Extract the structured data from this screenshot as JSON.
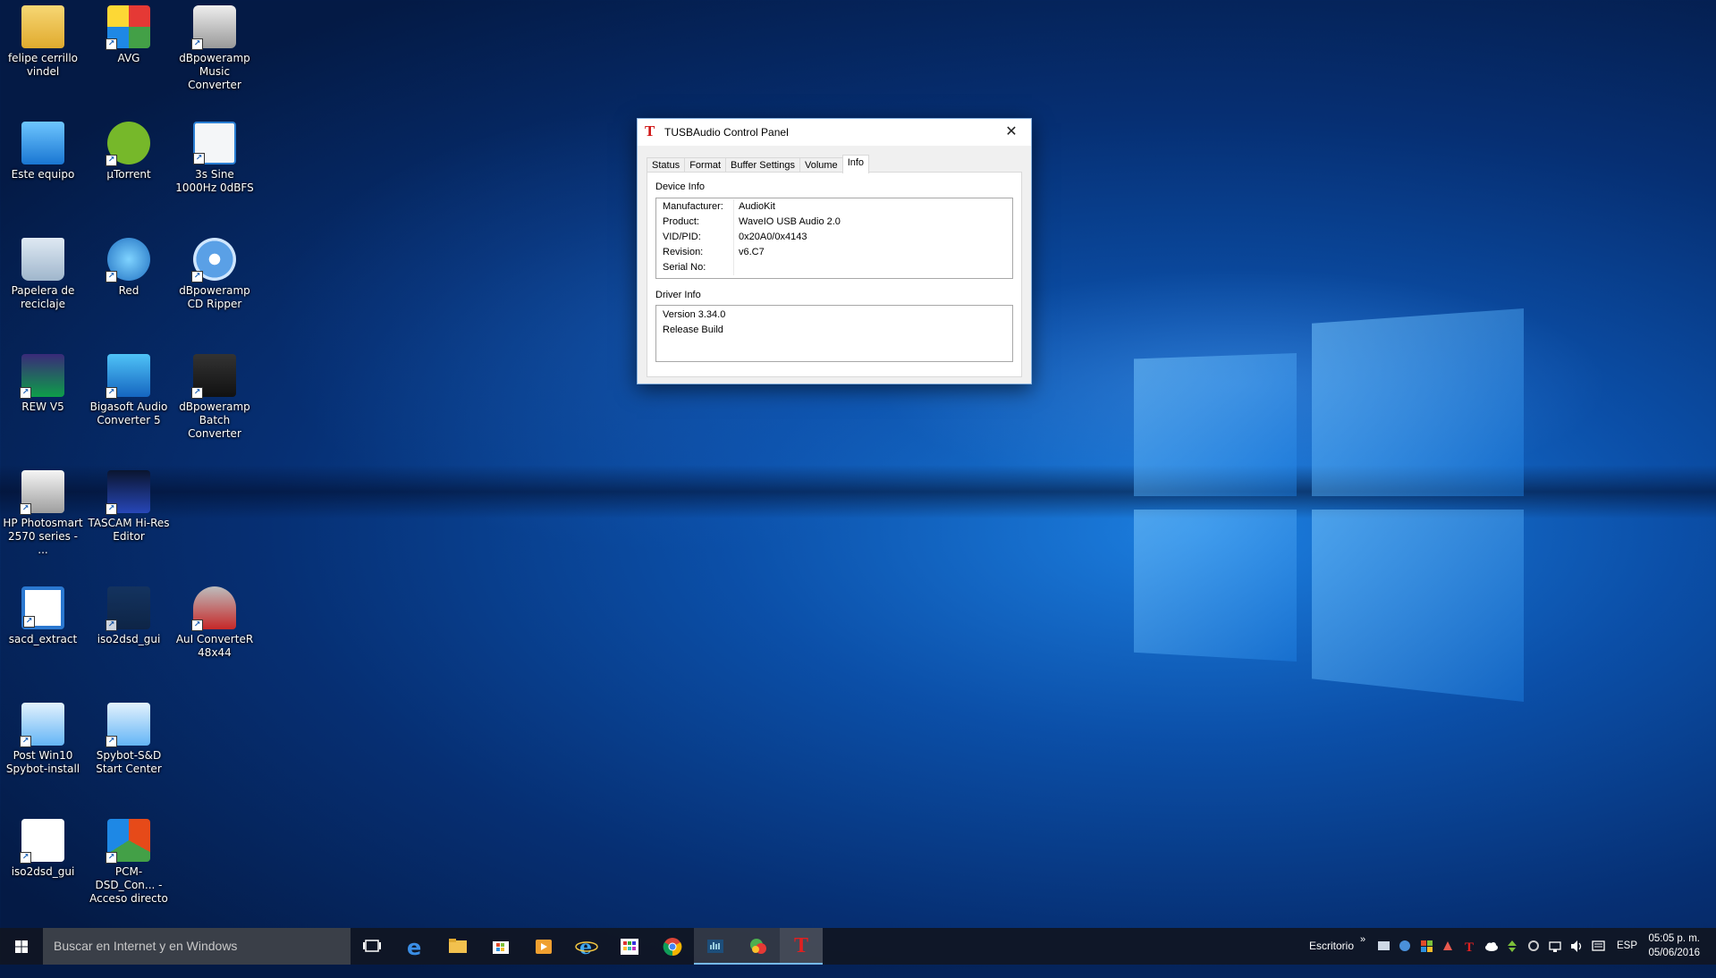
{
  "desktop": {
    "icons": [
      {
        "label": "felipe cerrillo vindel",
        "icon": "user-folder-icon"
      },
      {
        "label": "AVG",
        "icon": "avg-icon"
      },
      {
        "label": "dBpoweramp Music Converter",
        "icon": "speaker-icon"
      },
      {
        "label": "Este equipo",
        "icon": "computer-icon"
      },
      {
        "label": "µTorrent",
        "icon": "utorrent-icon"
      },
      {
        "label": "3s Sine 1000Hz 0dBFS",
        "icon": "audio-file-icon"
      },
      {
        "label": "Papelera de reciclaje",
        "icon": "recycle-bin-icon"
      },
      {
        "label": "Red",
        "icon": "network-icon"
      },
      {
        "label": "dBpoweramp CD Ripper",
        "icon": "cd-icon"
      },
      {
        "label": "REW V5",
        "icon": "rew-icon"
      },
      {
        "label": "Bigasoft Audio Converter 5",
        "icon": "music-note-icon"
      },
      {
        "label": "dBpoweramp Batch Converter",
        "icon": "batch-icon"
      },
      {
        "label": "HP Photosmart 2570 series - ...",
        "icon": "printer-icon"
      },
      {
        "label": "TASCAM Hi-Res Editor",
        "icon": "tascam-icon"
      },
      {
        "label": "sacd_extract",
        "icon": "window-icon"
      },
      {
        "label": "iso2dsd_gui",
        "icon": "waveform-icon"
      },
      {
        "label": "AuI ConverteR 48x44",
        "icon": "plug-icon"
      },
      {
        "label": "Post Win10 Spybot-install",
        "icon": "spybot-icon"
      },
      {
        "label": "Spybot-S&D Start Center",
        "icon": "spybot-icon"
      },
      {
        "label": "iso2dsd_gui",
        "icon": "java-icon"
      },
      {
        "label": "PCM-DSD_Con... - Acceso directo",
        "icon": "office-icon"
      }
    ]
  },
  "dialog": {
    "title": "TUSBAudio Control Panel",
    "logo": "T",
    "close": "✕",
    "tabs": [
      "Status",
      "Format",
      "Buffer Settings",
      "Volume",
      "Info"
    ],
    "active_tab": "Info",
    "device_info_label": "Device Info",
    "device_info": [
      {
        "key": "Manufacturer:",
        "value": "AudioKit"
      },
      {
        "key": "Product:",
        "value": "WaveIO USB Audio 2.0"
      },
      {
        "key": "VID/PID:",
        "value": "0x20A0/0x4143"
      },
      {
        "key": "Revision:",
        "value": "v6.C7"
      },
      {
        "key": "Serial No:",
        "value": ""
      }
    ],
    "driver_info_label": "Driver Info",
    "driver_info": [
      "Version 3.34.0",
      "Release Build"
    ]
  },
  "taskbar": {
    "search_placeholder": "Buscar en Internet y en Windows",
    "desktop_label": "Escritorio",
    "chevron": "»",
    "language": "ESP",
    "time": "05:05 p. m.",
    "date": "05/06/2016"
  }
}
